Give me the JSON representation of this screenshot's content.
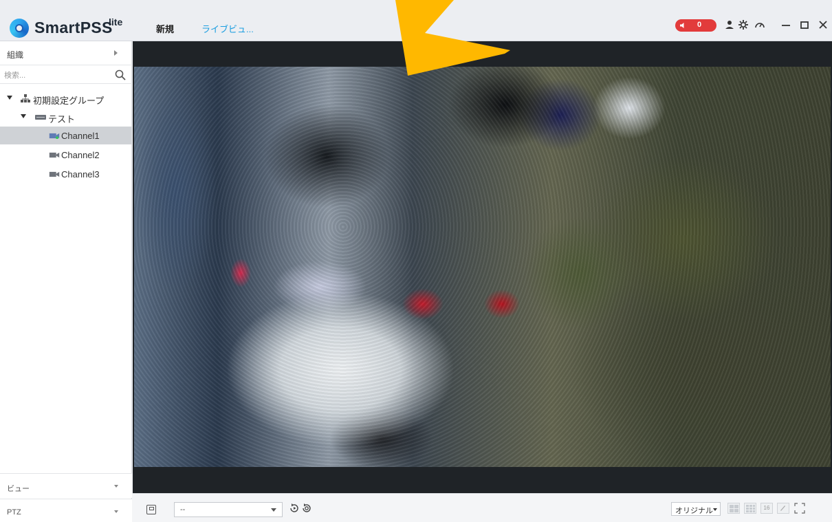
{
  "titlebar": {
    "app_name": "SmartPSS",
    "app_suffix": "lite",
    "tabs": [
      {
        "label": "新規"
      },
      {
        "label": "ライブビュ..."
      }
    ],
    "alarm_count": "0",
    "icons": [
      "user-icon",
      "gear-icon",
      "performance-icon",
      "minimize-icon",
      "maximize-icon",
      "close-icon"
    ]
  },
  "sidebar": {
    "section_label": "組織",
    "search_placeholder": "検索...",
    "tree": {
      "group": "初期設定グループ",
      "device": "テスト",
      "channels": [
        "Channel1",
        "Channel2",
        "Channel3"
      ],
      "selected_channel": "Channel1"
    },
    "footer": [
      {
        "label": "ビュー"
      },
      {
        "label": "PTZ"
      }
    ]
  },
  "toolbar": {
    "view_select_value": "--",
    "aspect_value": "オリジナル",
    "layout_16_label": "16"
  },
  "colors": {
    "accent": "#1a9de0",
    "alarm": "#e23b3b",
    "video_bg": "#1f2327",
    "selection": "#cfd2d6"
  }
}
